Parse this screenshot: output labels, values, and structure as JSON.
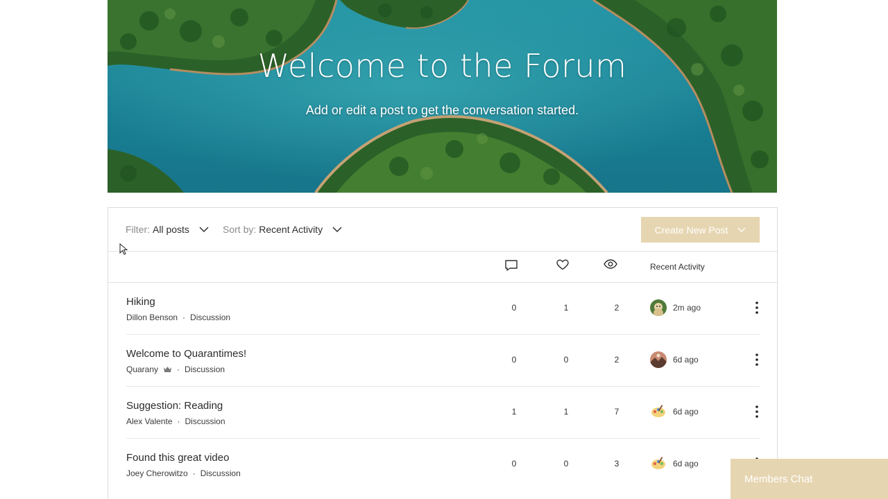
{
  "hero": {
    "title": "Welcome to the Forum",
    "subtitle": "Add or edit a post to get the conversation started."
  },
  "toolbar": {
    "filter": {
      "prefix": "Filter:",
      "value": "All posts"
    },
    "sort": {
      "prefix": "Sort by:",
      "value": "Recent Activity"
    },
    "create_label": "Create New Post"
  },
  "columns": {
    "comments_icon": "comment-icon",
    "likes_icon": "heart-icon",
    "views_icon": "eye-icon",
    "recent_label": "Recent Activity"
  },
  "posts": [
    {
      "title": "Hiking",
      "author": "Dillon Benson",
      "category": "Discussion",
      "comments": "0",
      "likes": "1",
      "views": "2",
      "ago": "2m ago",
      "avatar": "dog-avatar",
      "crown": false
    },
    {
      "title": "Welcome to Quarantimes!",
      "author": "Quarany",
      "category": "Discussion",
      "comments": "0",
      "likes": "0",
      "views": "2",
      "ago": "6d ago",
      "avatar": "landscape-avatar",
      "crown": true
    },
    {
      "title": "Suggestion: Reading",
      "author": "Alex Valente",
      "category": "Discussion",
      "comments": "1",
      "likes": "1",
      "views": "7",
      "ago": "6d ago",
      "avatar": "palette-avatar",
      "crown": false
    },
    {
      "title": "Found this great video",
      "author": "Joey Cherowitzo",
      "category": "Discussion",
      "comments": "0",
      "likes": "0",
      "views": "3",
      "ago": "6d ago",
      "avatar": "palette-avatar",
      "crown": false
    }
  ],
  "meta_separator": "·",
  "chat": {
    "label": "Members Chat"
  },
  "colors": {
    "accent": "#e6d5b1",
    "border": "#dcdcdc",
    "text": "#2b2b2b"
  }
}
